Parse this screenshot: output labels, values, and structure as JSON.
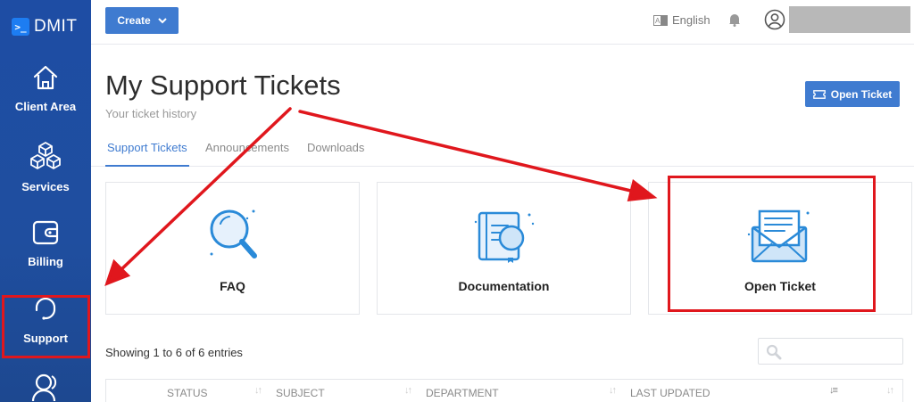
{
  "brand": {
    "name": "DMIT",
    "mark": ">_"
  },
  "sidebar": {
    "items": [
      {
        "label": "Client Area",
        "icon": "home-icon"
      },
      {
        "label": "Services",
        "icon": "cubes-icon"
      },
      {
        "label": "Billing",
        "icon": "wallet-icon"
      },
      {
        "label": "Support",
        "icon": "headset-icon"
      },
      {
        "label": "",
        "icon": "users-icon"
      }
    ]
  },
  "topbar": {
    "create_label": "Create",
    "language": "English"
  },
  "header": {
    "title": "My Support Tickets",
    "subtitle": "Your ticket history",
    "open_ticket_label": "Open Ticket"
  },
  "tabs": [
    {
      "label": "Support Tickets",
      "active": true
    },
    {
      "label": "Announcements",
      "active": false
    },
    {
      "label": "Downloads",
      "active": false
    }
  ],
  "cards": [
    {
      "title": "FAQ",
      "icon": "magnifier-icon"
    },
    {
      "title": "Documentation",
      "icon": "book-icon"
    },
    {
      "title": "Open Ticket",
      "icon": "envelope-icon"
    }
  ],
  "table": {
    "entries_text": "Showing 1 to 6 of 6 entries",
    "columns": [
      "STATUS",
      "SUBJECT",
      "DEPARTMENT",
      "LAST UPDATED"
    ]
  },
  "colors": {
    "sidebar": "#1e4da4",
    "accent": "#3f7bd0",
    "annotation_red": "#e0171d"
  }
}
